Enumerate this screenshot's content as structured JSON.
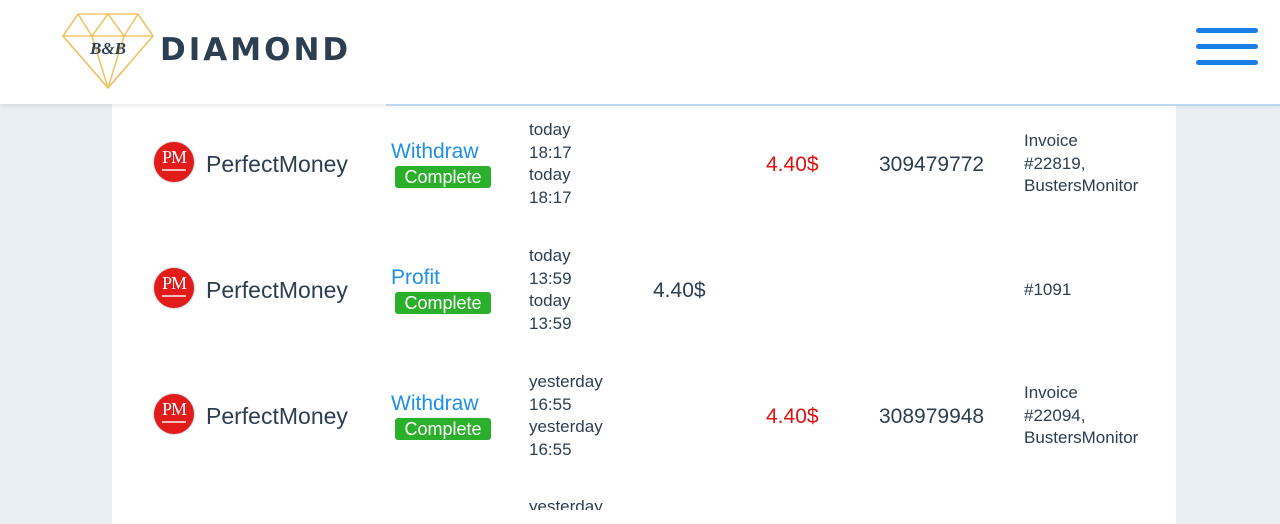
{
  "header": {
    "logo_monogram": "B&B",
    "logo_text": "DIAMOND",
    "menu_icon": "hamburger-menu-icon",
    "accent_color": "#1a7ee6"
  },
  "transactions": [
    {
      "payment_system": "PerfectMoney",
      "payment_logo": "PM",
      "type": "Withdraw",
      "status": "Complete",
      "date_created": [
        "today",
        "18:17"
      ],
      "date_processed": [
        "today",
        "18:17"
      ],
      "amount_in": "",
      "amount_out": "4.40$",
      "batch": "309479772",
      "memo": [
        "Invoice",
        "#22819,",
        "BustersMonitor"
      ]
    },
    {
      "payment_system": "PerfectMoney",
      "payment_logo": "PM",
      "type": "Profit",
      "status": "Complete",
      "date_created": [
        "today",
        "13:59"
      ],
      "date_processed": [
        "today",
        "13:59"
      ],
      "amount_in": "4.40$",
      "amount_out": "",
      "batch": "",
      "memo": [
        "#1091"
      ]
    },
    {
      "payment_system": "PerfectMoney",
      "payment_logo": "PM",
      "type": "Withdraw",
      "status": "Complete",
      "date_created": [
        "yesterday",
        "16:55"
      ],
      "date_processed": [
        "yesterday",
        "16:55"
      ],
      "amount_in": "",
      "amount_out": "4.40$",
      "batch": "308979948",
      "memo": [
        "Invoice",
        "#22094,",
        "BustersMonitor"
      ]
    }
  ],
  "partial_row": {
    "date_created": [
      "yesterday"
    ]
  }
}
